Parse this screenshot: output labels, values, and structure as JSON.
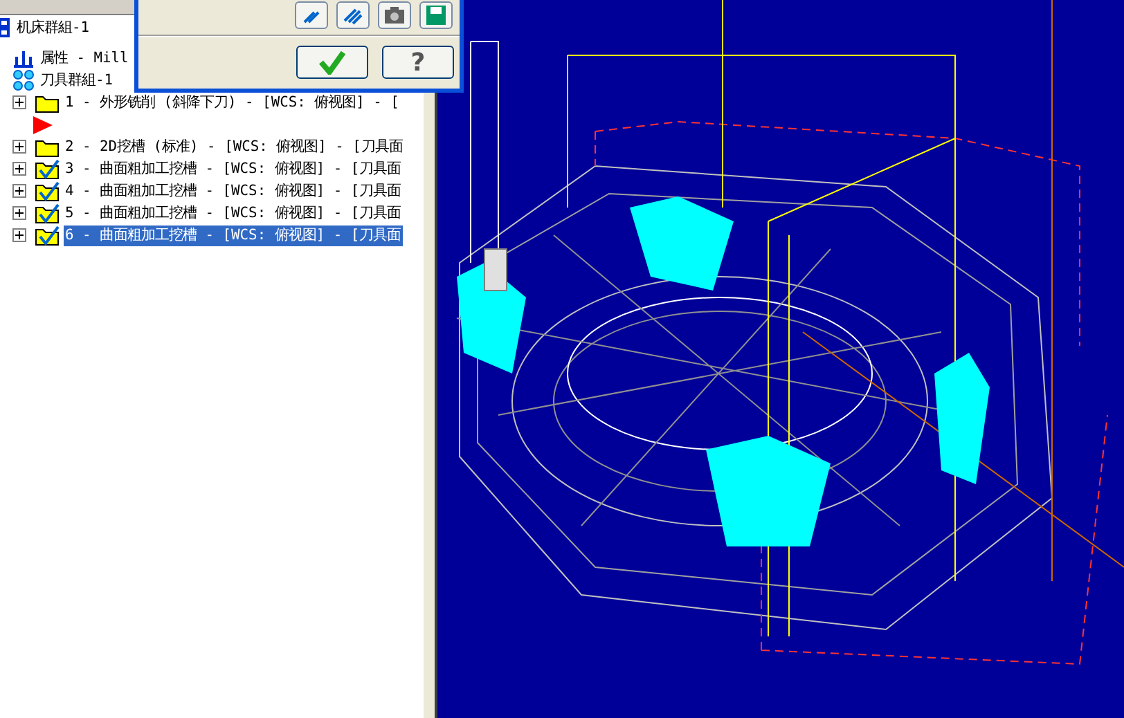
{
  "dialog": {
    "tool_buttons": [
      {
        "kind": "hatch"
      },
      {
        "kind": "hatch-dense"
      },
      {
        "kind": "camera"
      },
      {
        "kind": "save"
      }
    ],
    "ok_button": {
      "kind": "check"
    },
    "help_button": {
      "label": "?"
    }
  },
  "tree": {
    "label": "机床群組-1",
    "kind": "machine",
    "children": [
      {
        "label": "属性 - Mill",
        "kind": "properties"
      },
      {
        "label": "刀具群組-1",
        "kind": "toolgroup",
        "children": [
          {
            "label": "1 - 外形铣削 (斜降下刀) - [WCS: 俯视图] - [",
            "kind": "folder",
            "checked": false,
            "selected": false
          },
          {
            "kind": "flag"
          },
          {
            "label": "2 - 2D挖槽 (标准) - [WCS: 俯视图] - [刀具面",
            "kind": "folder",
            "checked": false,
            "selected": false
          },
          {
            "label": "3 - 曲面粗加工挖槽 - [WCS: 俯视图] - [刀具面",
            "kind": "folder",
            "checked": true,
            "selected": false
          },
          {
            "label": "4 - 曲面粗加工挖槽 - [WCS: 俯视图] - [刀具面",
            "kind": "folder",
            "checked": true,
            "selected": false
          },
          {
            "label": "5 - 曲面粗加工挖槽 - [WCS: 俯视图] - [刀具面",
            "kind": "folder",
            "checked": true,
            "selected": false
          },
          {
            "label": "6 - 曲面粗加工挖槽 - [WCS: 俯视图] - [刀具面",
            "kind": "folder",
            "checked": true,
            "selected": true
          }
        ]
      }
    ]
  }
}
